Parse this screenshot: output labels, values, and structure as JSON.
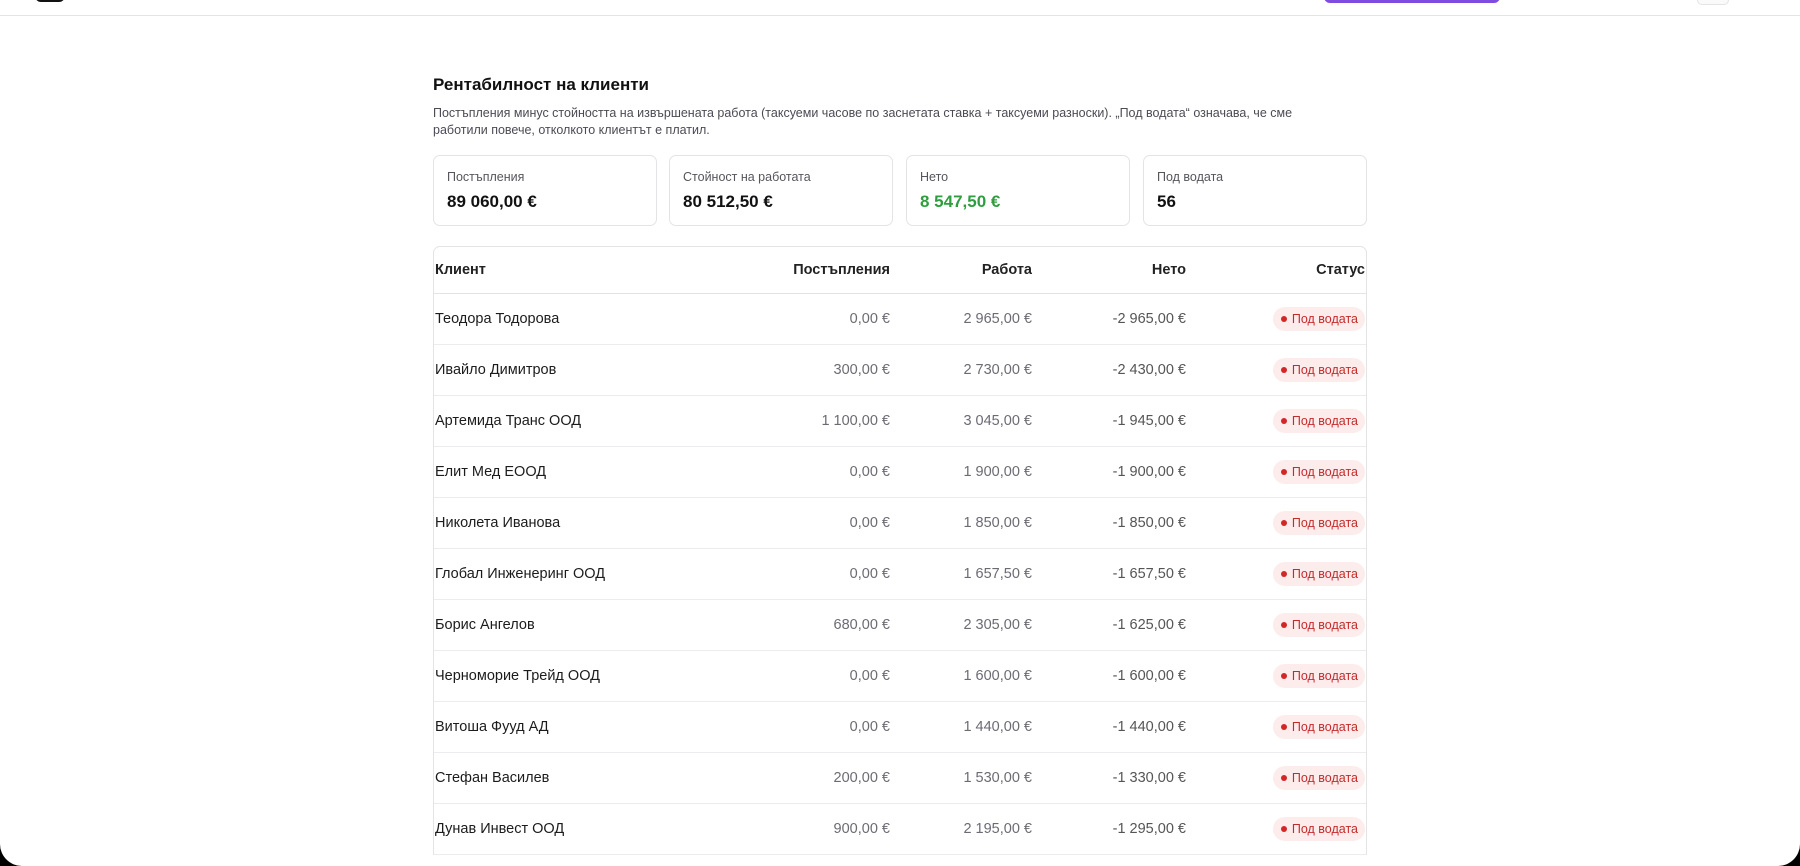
{
  "header": {
    "logo_icon": "app-logo-icon",
    "cta_color": "#7c4dde"
  },
  "page": {
    "title": "Рентабилност на клиенти",
    "description": "Постъпления минус стойността на извършената работа (таксуеми часове по заснетата ставка + таксуеми разноски). „Под водата“ означава, че сме работили повече, отколкото клиентът е платил."
  },
  "stats": [
    {
      "label": "Постъпления",
      "value": "89 060,00 €"
    },
    {
      "label": "Стойност на работата",
      "value": "80 512,50 €"
    },
    {
      "label": "Нето",
      "value": "8 547,50 €",
      "color": "#2f9e3f"
    },
    {
      "label": "Под водата",
      "value": "56"
    }
  ],
  "table": {
    "columns": [
      "Клиент",
      "Постъпления",
      "Работа",
      "Нето",
      "Статус"
    ],
    "rows": [
      {
        "client": "Теодора Тодорова",
        "income": "0,00 €",
        "work": "2 965,00 €",
        "net": "-2 965,00 €",
        "status": "Под водата"
      },
      {
        "client": "Ивайло Димитров",
        "income": "300,00 €",
        "work": "2 730,00 €",
        "net": "-2 430,00 €",
        "status": "Под водата"
      },
      {
        "client": "Артемида Транс ООД",
        "income": "1 100,00 €",
        "work": "3 045,00 €",
        "net": "-1 945,00 €",
        "status": "Под водата"
      },
      {
        "client": "Елит Мед ЕООД",
        "income": "0,00 €",
        "work": "1 900,00 €",
        "net": "-1 900,00 €",
        "status": "Под водата"
      },
      {
        "client": "Николета Иванова",
        "income": "0,00 €",
        "work": "1 850,00 €",
        "net": "-1 850,00 €",
        "status": "Под водата"
      },
      {
        "client": "Глобал Инженеринг ООД",
        "income": "0,00 €",
        "work": "1 657,50 €",
        "net": "-1 657,50 €",
        "status": "Под водата"
      },
      {
        "client": "Борис Ангелов",
        "income": "680,00 €",
        "work": "2 305,00 €",
        "net": "-1 625,00 €",
        "status": "Под водата"
      },
      {
        "client": "Черноморие Трейд ООД",
        "income": "0,00 €",
        "work": "1 600,00 €",
        "net": "-1 600,00 €",
        "status": "Под водата"
      },
      {
        "client": "Витоша Фууд АД",
        "income": "0,00 €",
        "work": "1 440,00 €",
        "net": "-1 440,00 €",
        "status": "Под водата"
      },
      {
        "client": "Стефан Василев",
        "income": "200,00 €",
        "work": "1 530,00 €",
        "net": "-1 330,00 €",
        "status": "Под водата"
      },
      {
        "client": "Дунав Инвест ООД",
        "income": "900,00 €",
        "work": "2 195,00 €",
        "net": "-1 295,00 €",
        "status": "Под водата"
      }
    ],
    "status_color": "#c42b2b"
  }
}
